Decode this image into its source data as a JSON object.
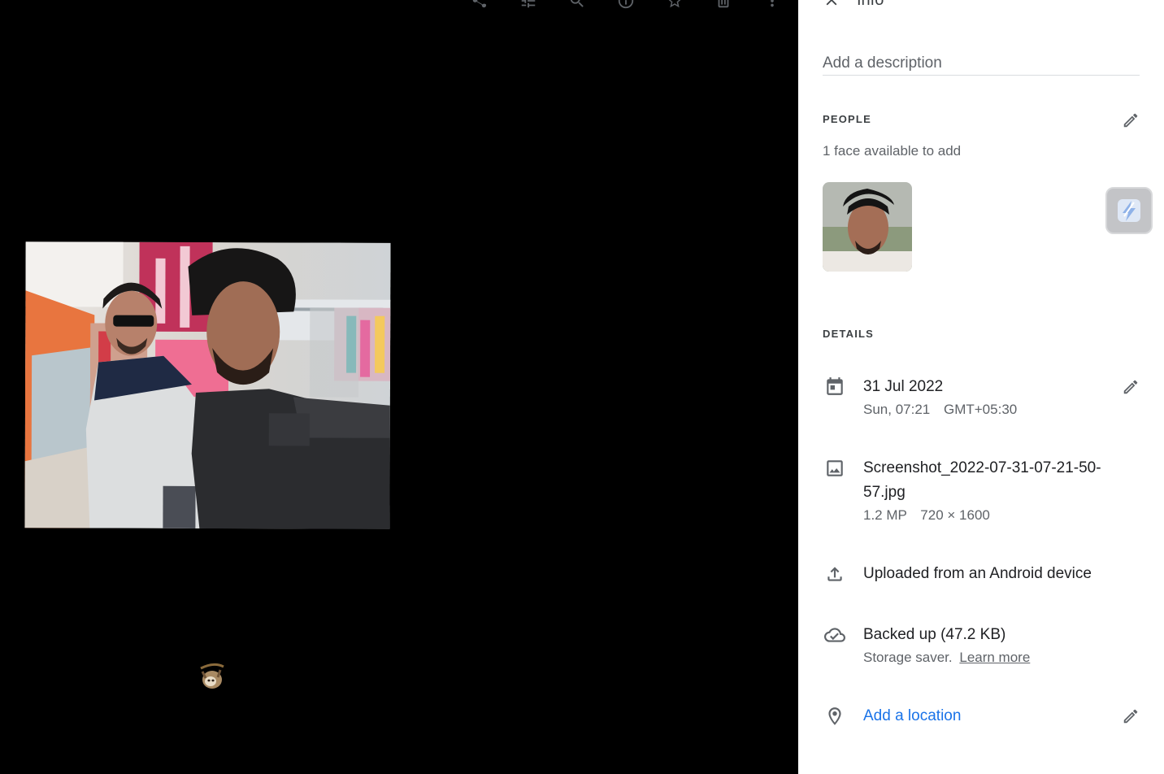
{
  "panel": {
    "title": "Info",
    "description_placeholder": "Add a description",
    "people": {
      "label": "PEOPLE",
      "faces_text": "1 face available to add"
    },
    "details": {
      "label": "DETAILS",
      "date": {
        "main": "31 Jul 2022",
        "day_time": "Sun, 07:21",
        "timezone": "GMT+05:30"
      },
      "file": {
        "name_line1": "Screenshot_2022-07-31-07-21-50-",
        "name_line2": "57.jpg",
        "megapixels": "1.2 MP",
        "dimensions": "720 × 1600"
      },
      "upload": {
        "text": "Uploaded from an Android device"
      },
      "backup": {
        "text": "Backed up (47.2 KB)",
        "sub": "Storage saver.",
        "link": "Learn more"
      },
      "location": {
        "text": "Add a location"
      }
    }
  },
  "toolbar": {
    "icons": [
      "share-icon",
      "tune-icon",
      "zoom-icon",
      "info-icon",
      "favorite-icon",
      "delete-icon",
      "more-icon"
    ]
  },
  "colors": {
    "viewer_bg": "#000000",
    "panel_bg": "#ffffff",
    "link_blue": "#1a73e8",
    "secondary_text": "#5f6368"
  }
}
